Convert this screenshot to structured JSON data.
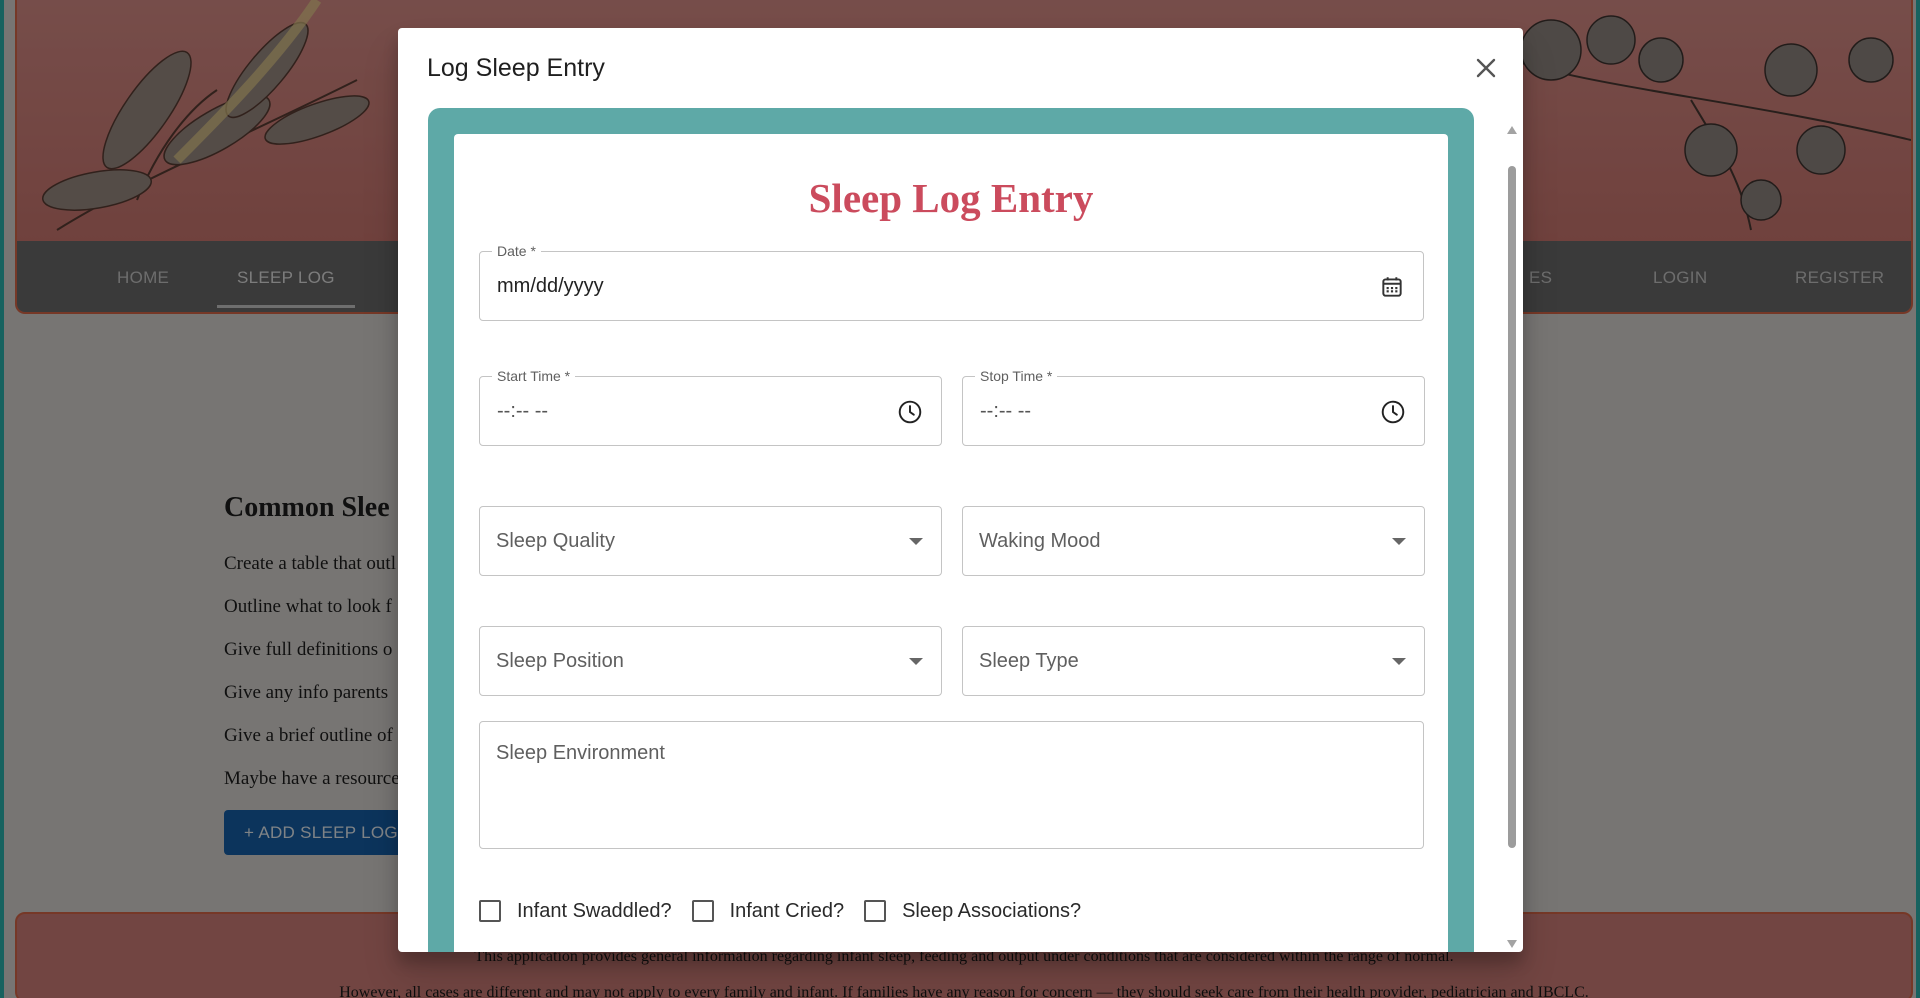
{
  "nav": {
    "items": [
      {
        "label": "Home",
        "active": false
      },
      {
        "label": "Sleep Log",
        "active": true
      },
      {
        "label": "es",
        "active": false
      },
      {
        "label": "Login",
        "active": false
      },
      {
        "label": "Register",
        "active": false
      }
    ]
  },
  "page": {
    "heading": "Common Slee",
    "lines": [
      "Create a table that outl",
      "Outline what to look f",
      "Give full definitions o",
      "Give any info parents",
      "Give a brief outline of",
      "Maybe have a resource"
    ],
    "add_button": "+ ADD SLEEP LOG E"
  },
  "footer": {
    "line1": "This application provides general information regarding infant sleep, feeding and output under conditions that are considered within the range of normal.",
    "line2": "However, all cases are different and may not apply to every family and infant. If families have any reason for concern — they should seek care from their health provider, pediatrician and IBCLC."
  },
  "modal": {
    "title": "Log Sleep Entry",
    "close_icon": "close-icon",
    "form": {
      "heading": "Sleep Log Entry",
      "date": {
        "label": "Date *",
        "value": "mm/dd/yyyy",
        "icon": "calendar-icon"
      },
      "start_time": {
        "label": "Start Time *",
        "value": "--:-- --",
        "icon": "clock-icon"
      },
      "stop_time": {
        "label": "Stop Time *",
        "value": "--:-- --",
        "icon": "clock-icon"
      },
      "sleep_quality": {
        "placeholder": "Sleep Quality"
      },
      "waking_mood": {
        "placeholder": "Waking Mood"
      },
      "sleep_position": {
        "placeholder": "Sleep Position"
      },
      "sleep_type": {
        "placeholder": "Sleep Type"
      },
      "sleep_environment": {
        "placeholder": "Sleep Environment"
      },
      "checkboxes": [
        {
          "label": "Infant Swaddled?",
          "checked": false
        },
        {
          "label": "Infant Cried?",
          "checked": false
        },
        {
          "label": "Sleep Associations?",
          "checked": false
        }
      ]
    }
  },
  "colors": {
    "accent_teal": "#5ea9a7",
    "heading_red": "#cb4b5d",
    "button_blue": "#1760a8",
    "banner_pink": "#cf7f79"
  }
}
